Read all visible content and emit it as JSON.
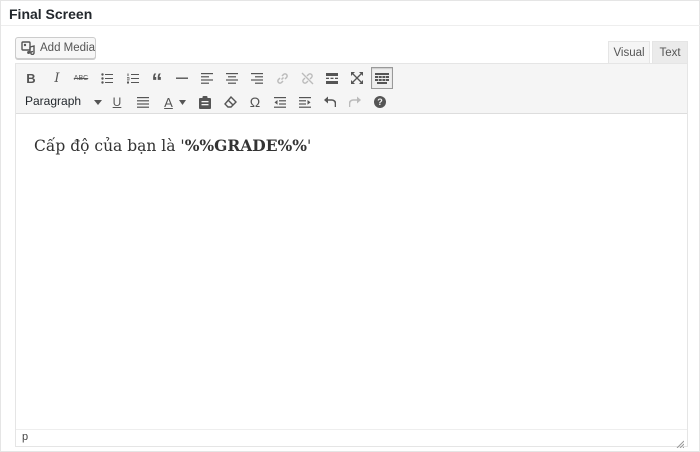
{
  "panel": {
    "title": "Final Screen"
  },
  "media": {
    "add_media_label": "Add Media"
  },
  "tabs": [
    {
      "label": "Visual",
      "active": true
    },
    {
      "label": "Text",
      "active": false
    }
  ],
  "toolbar": {
    "row1": [
      {
        "name": "bold-icon",
        "glyph": "B"
      },
      {
        "name": "italic-icon",
        "glyph": "I"
      },
      {
        "name": "strikethrough-icon",
        "glyph": "ABC"
      },
      {
        "name": "bulleted-list-icon"
      },
      {
        "name": "numbered-list-icon"
      },
      {
        "name": "blockquote-icon",
        "glyph": "“"
      },
      {
        "name": "horizontal-line-icon"
      },
      {
        "name": "align-left-icon"
      },
      {
        "name": "align-center-icon"
      },
      {
        "name": "align-right-icon"
      },
      {
        "name": "insert-link-icon"
      },
      {
        "name": "remove-link-icon"
      },
      {
        "name": "read-more-icon"
      },
      {
        "name": "fullscreen-icon"
      },
      {
        "name": "toolbar-toggle-icon",
        "active": true
      }
    ],
    "format_select_value": "Paragraph",
    "row2": [
      {
        "name": "underline-icon",
        "glyph": "U"
      },
      {
        "name": "justify-icon"
      },
      {
        "name": "text-color-icon",
        "glyph": "A"
      },
      {
        "name": "paste-as-text-icon"
      },
      {
        "name": "clear-formatting-icon"
      },
      {
        "name": "special-character-icon",
        "glyph": "Ω"
      },
      {
        "name": "outdent-icon"
      },
      {
        "name": "indent-icon"
      },
      {
        "name": "undo-icon"
      },
      {
        "name": "redo-icon",
        "disabled": true
      },
      {
        "name": "help-icon",
        "glyph": "?"
      }
    ]
  },
  "content": {
    "text_prefix": "Cấp độ của bạn là '",
    "text_bold": "%%GRADE%%",
    "text_suffix": "'"
  },
  "statusbar": {
    "path": "p"
  },
  "colors": {
    "toolbar_bg": "#f5f5f5",
    "border": "#e5e5e5",
    "icon": "#555555",
    "text": "#333333"
  }
}
